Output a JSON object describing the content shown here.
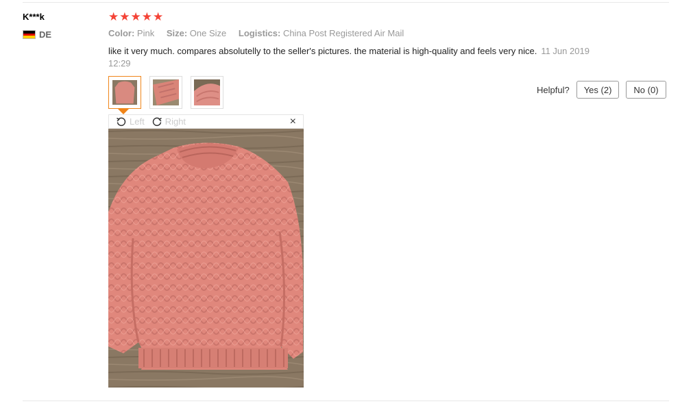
{
  "reviewer": {
    "name": "K***k",
    "country_code": "DE"
  },
  "rating": {
    "stars": 5
  },
  "attributes": [
    {
      "key": "Color:",
      "value": "Pink"
    },
    {
      "key": "Size:",
      "value": "One Size"
    },
    {
      "key": "Logistics:",
      "value": "China Post Registered Air Mail"
    }
  ],
  "review": {
    "text": "like it very much. compares absolutelly to the seller's pictures. the material is high-quality and feels very nice.",
    "date": "11 Jun 2019 12:29"
  },
  "helpful": {
    "label": "Helpful?",
    "yes": "Yes (2)",
    "no": "No (0)"
  },
  "viewer": {
    "rotate_left": "Left",
    "rotate_right": "Right",
    "close": "×"
  },
  "colors": {
    "star": "#f44336",
    "accent": "#f08519",
    "sweater": "#e08a80",
    "floor": "#8a7863"
  }
}
